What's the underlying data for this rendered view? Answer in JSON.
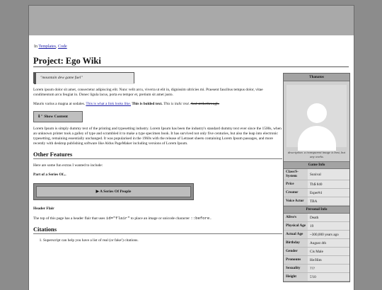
{
  "breadcrumb": {
    "prefix": "In",
    "links": [
      "Templates",
      "Code"
    ]
  },
  "page_title": "Project: Ego Wiki",
  "quote": "\"mountain dew game fuel\"",
  "intro": "Lorem ipsum dolor sit amet, consectetur adipiscing elit. Nunc velit arcu, viverra ut elit in, dignissim ultricies mi. Praesent faucibus tempus dolor, vitae condimentum arcu feugiat in. Donec ligula lacus, porta eu tempor et, pretium sit amet justo.",
  "styles_line": {
    "lead": "Mauris varius a magna at sodales.",
    "link": "This is what a link looks like.",
    "bold": "This is bolded text.",
    "italic": "This is italic text.",
    "strike": "And strikethrough."
  },
  "show_button": "⇓\" Show Content",
  "lorem2": "Lorem Ipsum is simply dummy text of the printing and typesetting industry. Lorem Ipsum has been the industry's standard dummy text ever since the 1500s, when an unknown printer took a galley of type and scrambled it to make a type specimen book. It has survived not only five centuries, but also the leap into electronic typesetting, remaining essentially unchanged. It was popularised in the 1960s with the release of Letraset sheets containing Lorem Ipsum passages, and more recently with desktop publishing software like Aldus PageMaker including versions of Lorem Ipsum.",
  "features": {
    "heading": "Other Features",
    "intro": "Here are some fun extras I wanted to include:",
    "series_label": "Part of a Series Of...",
    "series_button": "▶ A Series Of People",
    "flair_heading": "Header Flair",
    "flair_text_a": "The top of this page has a header flair that uses",
    "flair_code_a": "id=\"flair\"",
    "flair_text_b": "to place an image or unicode character",
    "flair_code_b": "::before."
  },
  "citations": {
    "heading": "Citations",
    "items": [
      "Superscript can help you have a list of real (or fake!) citations."
    ]
  },
  "infobox": {
    "name": "Thanatos",
    "caption": "description. a transparent image is best, but any works",
    "game_info_title": "Game Info",
    "game_info": [
      {
        "k": "Class/S-System",
        "v": "Sunival"
      },
      {
        "k": "Price",
        "v": "Th$ 840"
      },
      {
        "k": "Creator",
        "v": "Esper#4"
      },
      {
        "k": "Voice Actor",
        "v": "TBA"
      }
    ],
    "personal_title": "Personal Info",
    "personal_info": [
      {
        "k": "Alive/s",
        "v": "Death"
      },
      {
        "k": "Physical Age",
        "v": "19"
      },
      {
        "k": "Actual Age",
        "v": "~300,000 years ago"
      },
      {
        "k": "Birthday",
        "v": "August 4th"
      },
      {
        "k": "Gender",
        "v": "Cis Male"
      },
      {
        "k": "Pronouns",
        "v": "He/Him"
      },
      {
        "k": "Sexuality",
        "v": "???"
      },
      {
        "k": "Height",
        "v": "5'10"
      }
    ]
  }
}
